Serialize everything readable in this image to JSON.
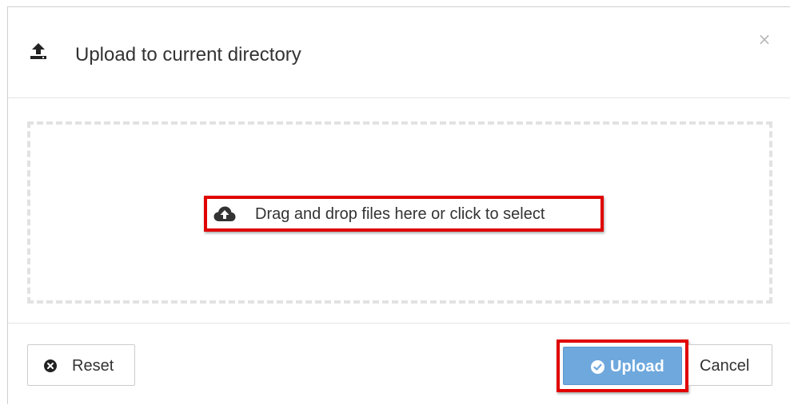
{
  "dialog": {
    "title": "Upload to current directory",
    "close_label": "×"
  },
  "dropzone": {
    "prompt": "Drag and drop files here or click to select"
  },
  "footer": {
    "reset_label": "Reset",
    "upload_label": "Upload",
    "cancel_label": "Cancel"
  },
  "icons": {
    "header": "upload-icon",
    "dropzone": "cloud-upload-icon",
    "reset": "times-circle-icon",
    "upload": "check-circle-icon"
  },
  "colors": {
    "primary_button": "#6ea8dd",
    "highlight": "#e00000",
    "dropzone_border": "#e2e2e2"
  }
}
